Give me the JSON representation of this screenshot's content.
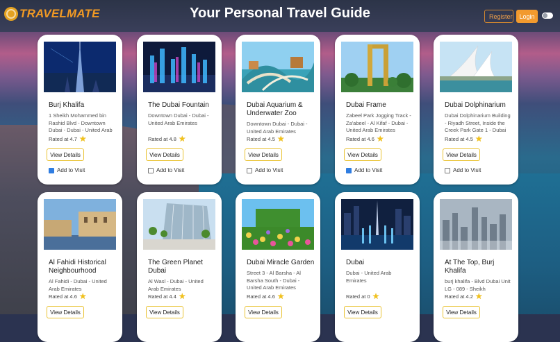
{
  "header": {
    "logo_text": "TRAVELMATE",
    "title": "Your Personal Travel Guide",
    "register_label": "Register",
    "login_label": "Login"
  },
  "cards": [
    {
      "name": "Burj Khalifa",
      "address": "1 Sheikh Mohammed bin Rashid Blvd - Downtown Dubai - Dubai - United Arab",
      "rating": "Rated at 4.7",
      "button": "View Details",
      "checkbox": "Add to Visit",
      "checked": true
    },
    {
      "name": "The Dubai Fountain",
      "address": "Downtown Dubai - Dubai - United Arab Emirates",
      "rating": "Rated at 4.8",
      "button": "View Details",
      "checkbox": "Add to Visit",
      "checked": false
    },
    {
      "name": "Dubai Aquarium & Underwater Zoo",
      "address": "Downtown Dubai - Dubai - United Arab Emirates",
      "rating": "Rated at 4.5",
      "button": "View Details",
      "checkbox": "Add to Visit",
      "checked": false
    },
    {
      "name": "Dubai Frame",
      "address": "Zabeel Park Jogging Track - Za'abeel - Al Kifaf - Dubai - United Arab Emirates",
      "rating": "Rated at 4.6",
      "button": "View Details",
      "checkbox": "Add to Visit",
      "checked": true
    },
    {
      "name": "Dubai Dolphinarium",
      "address": "Dubai Dolphinarium Building - Riyadh Street, Inside the Creek Park Gate 1 - Dubai",
      "rating": "Rated at 4.5",
      "button": "View Details",
      "checkbox": "Add to Visit",
      "checked": false
    },
    {
      "name": "Al Fahidi Historical Neighbourhood",
      "address": "Al Fahidi - Dubai - United Arab Emirates",
      "rating": "Rated at 4.6",
      "button": "View Details"
    },
    {
      "name": "The Green Planet Dubai",
      "address": "Al Wasl - Dubai - United Arab Emirates",
      "rating": "Rated at 4.4",
      "button": "View Details"
    },
    {
      "name": "Dubai Miracle Garden",
      "address": "Street 3 - Al Barsha - Al Barsha South - Dubai - United Arab Emirates",
      "rating": "Rated at 4.6",
      "button": "View Details"
    },
    {
      "name": "Dubai",
      "address": "Dubai - United Arab Emirates",
      "rating": "Rated at 0",
      "button": "View Details"
    },
    {
      "name": "At The Top, Burj Khalifa",
      "address": "burj khalifa - Blvd Dubai Unit LG - 089 - Sheikh",
      "rating": "Rated at 4.2",
      "button": "View Details"
    }
  ]
}
